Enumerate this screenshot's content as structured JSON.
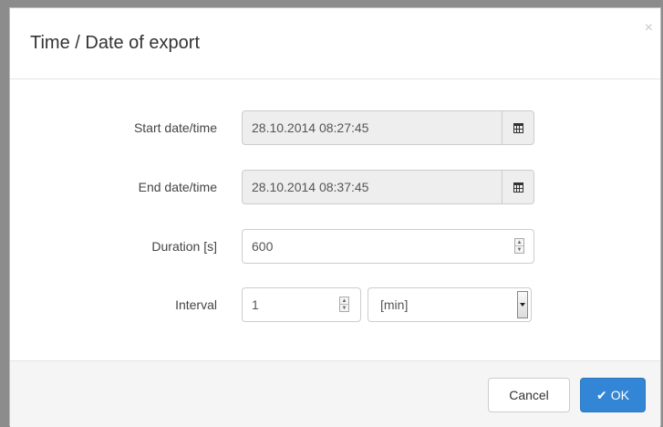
{
  "dialog": {
    "title": "Time / Date of export",
    "close_glyph": "×"
  },
  "form": {
    "start": {
      "label": "Start date/time",
      "value": "28.10.2014 08:27:45",
      "icon": "calendar-icon"
    },
    "end": {
      "label": "End date/time",
      "value": "28.10.2014 08:37:45",
      "icon": "calendar-icon"
    },
    "duration": {
      "label": "Duration [s]",
      "value": "600"
    },
    "interval": {
      "label": "Interval",
      "value": "1",
      "unit_selected": "[min]"
    }
  },
  "footer": {
    "cancel_label": "Cancel",
    "ok_label": "OK",
    "ok_icon": "check-icon"
  },
  "colors": {
    "primary": "#3385d6",
    "readonly_bg": "#eeeeee",
    "footer_bg": "#f5f5f5"
  }
}
